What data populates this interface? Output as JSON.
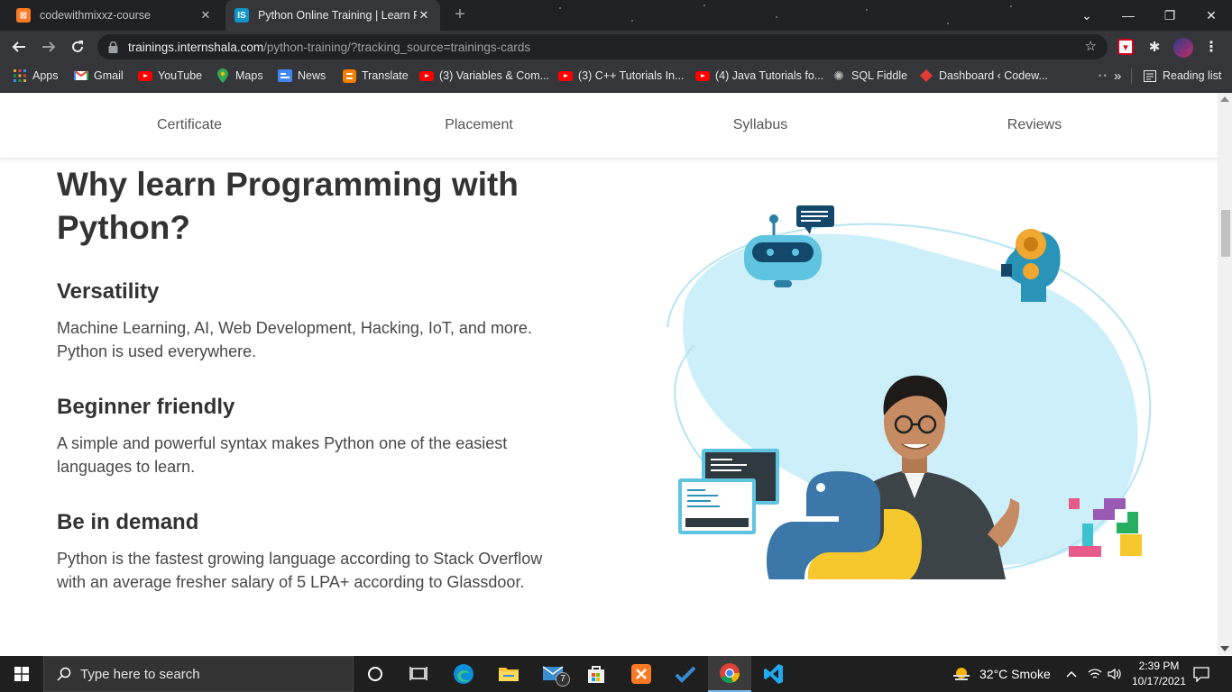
{
  "tabs": [
    {
      "title": "codewithmixxz-course",
      "favicon": "xampp-icon",
      "close": "✕"
    },
    {
      "title": "Python Online Training | Learn Py",
      "favicon": "IS",
      "close": "✕"
    }
  ],
  "window_controls": {
    "tab_search": "⌄",
    "minimize": "—",
    "restore": "❐",
    "close": "✕"
  },
  "address_bar": {
    "host": "trainings.internshala.com",
    "path": "/python-training/?tracking_source=trainings-cards"
  },
  "bookmarks": [
    {
      "label": "Apps",
      "icon": "apps-grid-icon"
    },
    {
      "label": "Gmail",
      "icon": "gmail-icon"
    },
    {
      "label": "YouTube",
      "icon": "youtube-icon"
    },
    {
      "label": "Maps",
      "icon": "maps-pin-icon"
    },
    {
      "label": "News",
      "icon": "news-icon"
    },
    {
      "label": "Translate",
      "icon": "blogger-icon"
    },
    {
      "label": "(3) Variables & Com...",
      "icon": "youtube-icon"
    },
    {
      "label": "(3) C++ Tutorials In...",
      "icon": "youtube-icon"
    },
    {
      "label": "(4) Java Tutorials fo...",
      "icon": "youtube-icon"
    },
    {
      "label": "SQL Fiddle",
      "icon": "gear-icon"
    },
    {
      "label": "Dashboard ‹ Codew...",
      "icon": "codewithharry-icon"
    }
  ],
  "bookmarks_overflow": "»",
  "reading_list": "Reading list",
  "section_nav": [
    "Certificate",
    "Placement",
    "Syllabus",
    "Reviews"
  ],
  "content": {
    "heading": "Why learn Programming with Python?",
    "points": [
      {
        "title": "Versatility",
        "text": "Machine Learning, AI, Web Development, Hacking, IoT, and more. Python is used everywhere."
      },
      {
        "title": "Beginner friendly",
        "text": "A simple and powerful syntax makes Python one of the easiest languages to learn."
      },
      {
        "title": "Be in demand",
        "text": "Python is the fastest growing language according to Stack Overflow with an average fresher salary of 5 LPA+ according to Glassdoor."
      }
    ]
  },
  "taskbar": {
    "search_placeholder": "Type here to search",
    "mail_badge": "7",
    "weather": "32°C  Smoke",
    "time": "2:39 PM",
    "date": "10/17/2021"
  },
  "colors": {
    "python_blue": "#3b77a8",
    "python_yellow": "#f7c82d",
    "blob": "#cdeff9",
    "accent_blue": "#1a73e8"
  }
}
